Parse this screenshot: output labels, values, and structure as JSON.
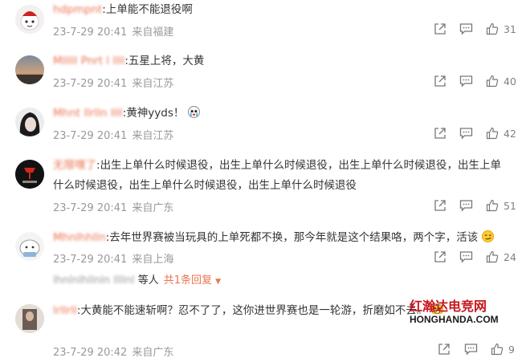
{
  "colors": {
    "accent": "#eb7350",
    "meta": "#999999",
    "watermark_red": "#c8161d"
  },
  "comments": [
    {
      "user": "hdpmpnt",
      "content": "上单能不能退役啊",
      "date": "23-7-29 20:41",
      "location": "来自福建",
      "likes": "31"
    },
    {
      "user": "Mlllll Pnrt l llll",
      "content": "五星上将，大黄",
      "date": "23-7-29 20:41",
      "location": "来自江苏",
      "likes": "40"
    },
    {
      "user": "Mhnt llrlln llll",
      "content": "黄神yyds！",
      "date": "23-7-29 20:41",
      "location": "来自江苏",
      "likes": "42"
    },
    {
      "user": "无限嘿了",
      "content": "出生上单什么时候退役，出生上单什么时候退役，出生上单什么时候退役，出生上单什么时候退役，出生上单什么时候退役，出生上单什么时候退役",
      "date": "23-7-29 20:41",
      "location": "来自广东",
      "likes": "51"
    },
    {
      "user": "Mhnlhhlln",
      "content": "去年世界赛被当玩具的上单死都不换，那今年就是这个结果咯，两个字，活该",
      "date": "23-7-29 20:41",
      "location": "来自上海",
      "likes": "24"
    },
    {
      "user": "lrllrll",
      "content": "大黄能不能速斩啊？忍不了了，这你进世界赛也是一轮游，折磨",
      "content_tail": "如不去。",
      "date": "23-7-29 20:42",
      "location": "来自广东",
      "likes": "9"
    }
  ],
  "reply_summary": {
    "names": "lhnlnlhllnln llllnl",
    "suffix": "等人",
    "link": "共1条回复",
    "arrow": "▼"
  },
  "watermark": {
    "top": "红瀚达电竞网",
    "bottom": "HONGHANDA.COM"
  },
  "icons": {
    "share": "share-icon",
    "comment": "comment-icon",
    "like": "thumbs-up-icon"
  }
}
